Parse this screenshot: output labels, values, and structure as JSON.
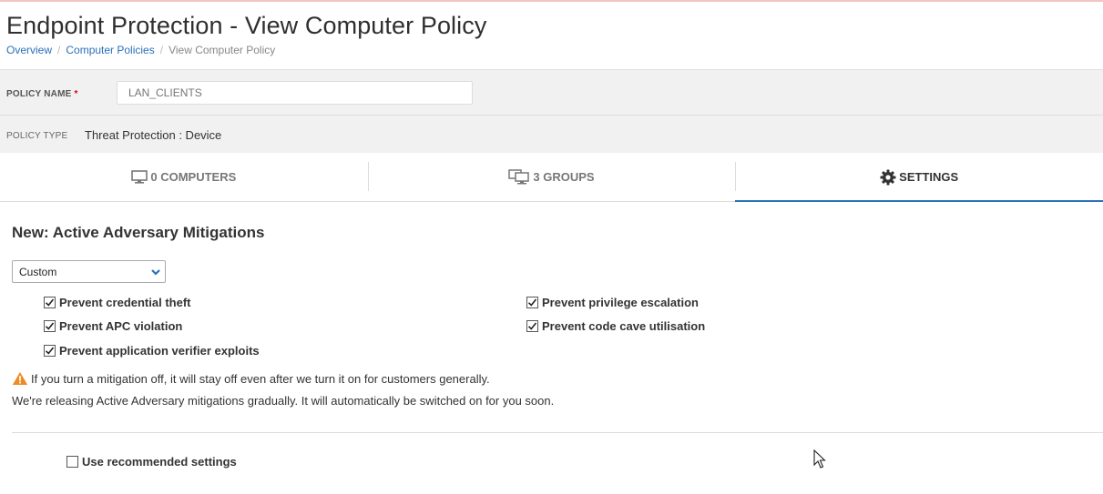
{
  "page": {
    "title": "Endpoint Protection - View Computer Policy"
  },
  "breadcrumb": [
    {
      "label": "Overview"
    },
    {
      "label": "Computer Policies"
    },
    {
      "label": "View Computer Policy"
    }
  ],
  "policy_name": {
    "label": "POLICY NAME",
    "required_mark": "*",
    "value": "",
    "placeholder": "LAN_CLIENTS"
  },
  "policy_type": {
    "label": "POLICY TYPE",
    "value": "Threat Protection : Device"
  },
  "tabs": [
    {
      "label": "0 COMPUTERS",
      "icon": "monitor-icon",
      "active": false
    },
    {
      "label": "3 GROUPS",
      "icon": "monitors-icon",
      "active": false
    },
    {
      "label": "SETTINGS",
      "icon": "gear-icon",
      "active": true
    }
  ],
  "settings": {
    "section_title": "New: Active Adversary Mitigations",
    "mode_select": {
      "selected": "Custom"
    },
    "options": [
      {
        "label": "Prevent credential theft",
        "checked": true
      },
      {
        "label": "Prevent APC violation",
        "checked": true
      },
      {
        "label": "Prevent application verifier exploits",
        "checked": true
      },
      {
        "label": "Prevent privilege escalation",
        "checked": true
      },
      {
        "label": "Prevent code cave utilisation",
        "checked": true
      }
    ],
    "warning": "If you turn a mitigation off, it will stay off even after we turn it on for customers generally.",
    "note": "We're releasing Active Adversary mitigations gradually. It will automatically be switched on for you soon.",
    "recommended": {
      "label": "Use recommended settings",
      "checked": false
    }
  },
  "colors": {
    "link": "#2a71b8",
    "active_tab_underline": "#2a71b8",
    "required": "#d0021b",
    "warning": "#f08a24"
  }
}
